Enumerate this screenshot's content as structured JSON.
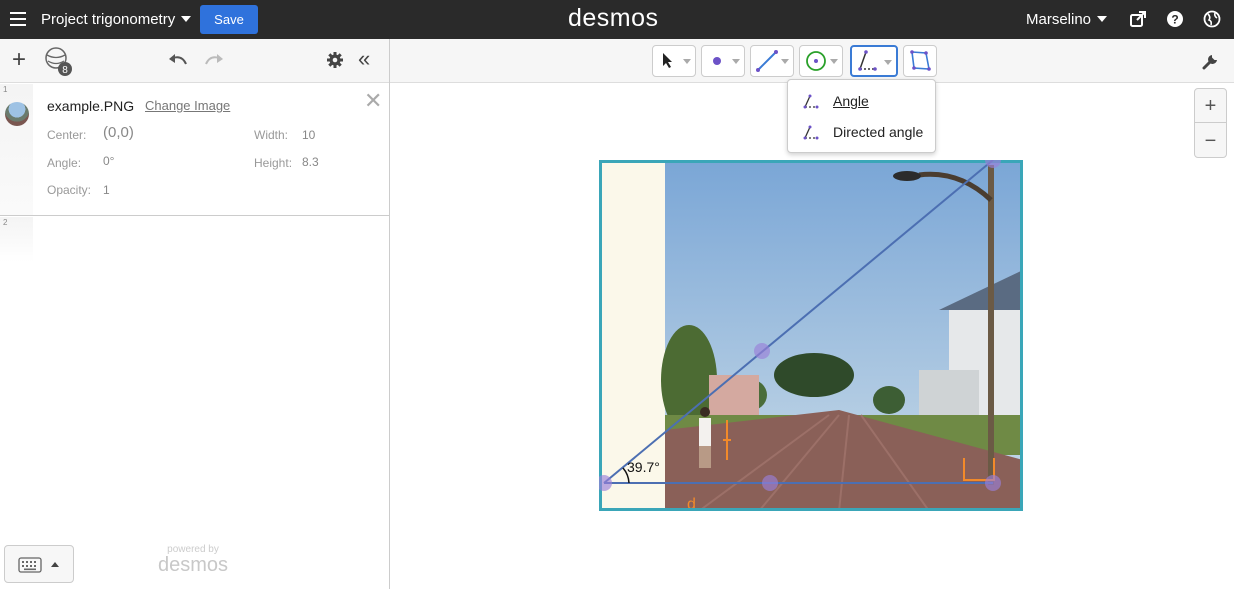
{
  "header": {
    "menu_icon": "hamburger-icon",
    "project_title": "Project trigonometry",
    "save_label": "Save",
    "logo": "desmos",
    "user_name": "Marselino",
    "icons": [
      "share-icon",
      "help-icon",
      "globe-icon"
    ]
  },
  "left_panel": {
    "toolbar_icons": [
      "add-icon",
      "globe-icon",
      "undo-icon",
      "redo-icon",
      "settings-icon",
      "collapse-icon"
    ],
    "globe_badge": "8",
    "expressions": [
      {
        "index": "1",
        "image_name": "example.PNG",
        "change_image_link": "Change Image",
        "center_label": "Center:",
        "center_value": "(0,0)",
        "width_label": "Width:",
        "width_value": "10",
        "angle_label": "Angle:",
        "angle_value": "0°",
        "height_label": "Height:",
        "height_value": "8.3",
        "opacity_label": "Opacity:",
        "opacity_value": "1"
      },
      {
        "index": "2"
      }
    ],
    "powered_by": "powered by",
    "powered_brand": "desmos"
  },
  "graph_toolbar": {
    "tools": [
      "pointer-tool",
      "point-tool",
      "line-tool",
      "circle-tool",
      "angle-tool",
      "polygon-tool"
    ],
    "active_tool": "angle-tool",
    "wrench_icon": "wrench-icon"
  },
  "angle_dropdown": {
    "items": [
      "Angle",
      "Directed angle"
    ]
  },
  "zoom": {
    "in": "+",
    "out": "−"
  },
  "graph": {
    "angle_label": "39.7°",
    "colors": {
      "line": "#4c6fb2",
      "point": "#9a80d8",
      "border": "#3aa6b8",
      "measure": "#f28a2a"
    }
  }
}
